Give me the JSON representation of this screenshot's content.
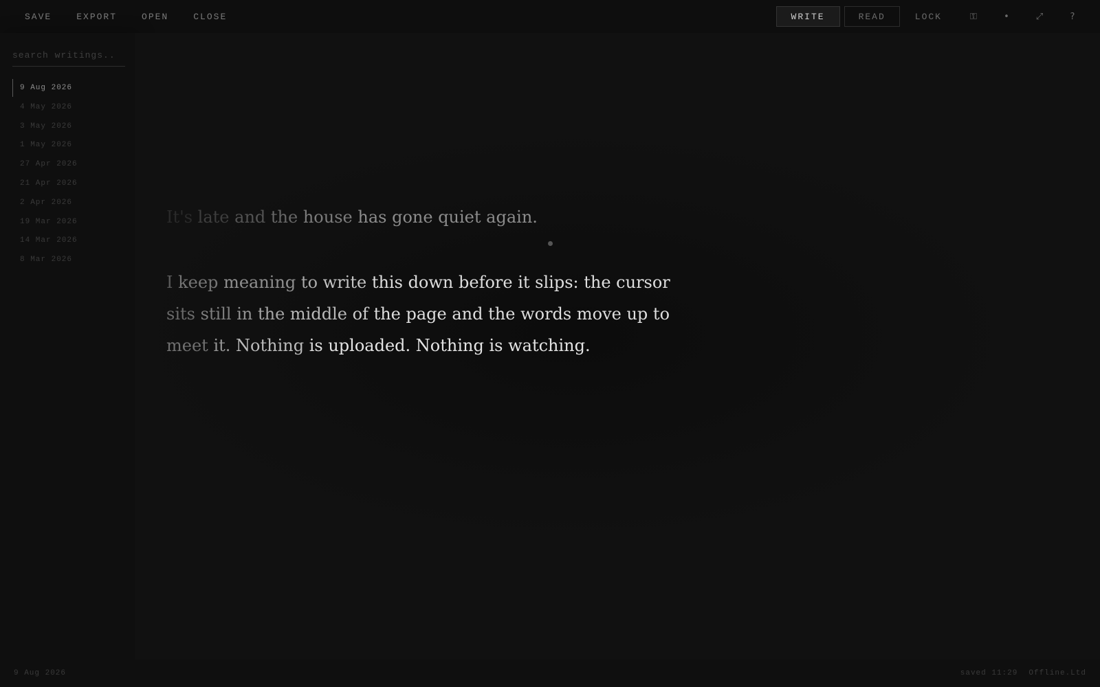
{
  "toolbar": {
    "left_menu": [
      "SAVE",
      "EXPORT",
      "OPEN",
      "CLOSE"
    ],
    "modes": [
      {
        "label": "WRITE",
        "active": true
      },
      {
        "label": "READ",
        "active": false
      }
    ],
    "lock_label": "LOCK",
    "icons": [
      {
        "name": "key-icon",
        "glyph": "⚿"
      },
      {
        "name": "dot-icon",
        "glyph": "•"
      },
      {
        "name": "expand-icon",
        "glyph": "⤢"
      },
      {
        "name": "help-icon",
        "glyph": "?"
      }
    ]
  },
  "sidebar": {
    "search_placeholder": "search writings..",
    "entries": [
      {
        "label": "9 Aug 2026",
        "active": true
      },
      {
        "label": "4 May 2026",
        "active": false
      },
      {
        "label": "3 May 2026",
        "active": false
      },
      {
        "label": "1 May 2026",
        "active": false
      },
      {
        "label": "27 Apr 2026",
        "active": false
      },
      {
        "label": "21 Apr 2026",
        "active": false
      },
      {
        "label": "2 Apr 2026",
        "active": false
      },
      {
        "label": "19 Mar 2026",
        "active": false
      },
      {
        "label": "14 Mar 2026",
        "active": false
      },
      {
        "label": "8 Mar 2026",
        "active": false
      }
    ]
  },
  "editor": {
    "previous_paragraph": "It's late and the house has gone quiet again.",
    "current_paragraph_lines": [
      "I keep meaning to write this down before it slips: the cursor",
      "sits still in the middle of the page and the words move up to",
      "meet it. Nothing is uploaded. Nothing is watching."
    ]
  },
  "footer": {
    "date": "9 Aug 2026",
    "saved": "saved 11:29",
    "brand": "Offline.Ltd"
  },
  "colors": {
    "background": "#101010",
    "text_bright": "#d8d8d8",
    "text_dim": "#3a3a3a",
    "active_mode_bg": "#1b1b1b"
  }
}
